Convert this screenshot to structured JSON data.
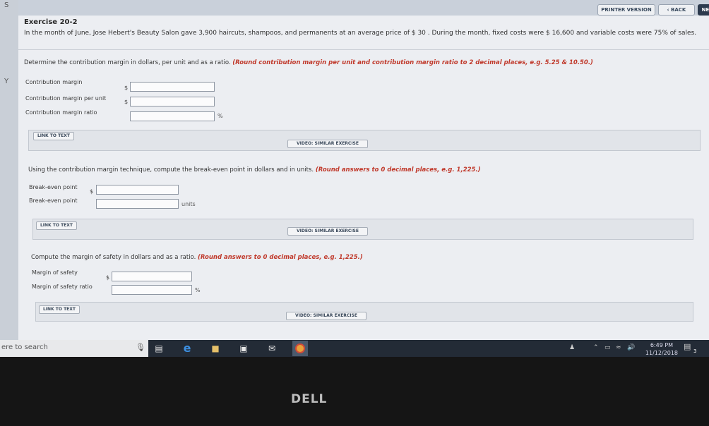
{
  "left_strip": {
    "top_char": "S",
    "mid_char": "Y"
  },
  "header": {
    "printer_version": "PRINTER VERSION",
    "back": "‹ BACK",
    "next": "NE"
  },
  "exercise": {
    "title": "Exercise 20-2",
    "problem": "In the month of June, Jose Hebert's Beauty Salon gave 3,900 haircuts, shampoos, and permanents at an average price of $ 30 . During the month, fixed costs were $ 16,600 and variable costs were 75% of sales."
  },
  "part1": {
    "question": "Determine the contribution margin in dollars, per unit and as a ratio.",
    "instruction": "(Round contribution margin per unit and contribution margin ratio to 2 decimal places, e.g. 5.25 & 10.50.)",
    "rows": [
      {
        "label": "Contribution margin",
        "prefix": "$",
        "value": "",
        "suffix": ""
      },
      {
        "label": "Contribution margin per unit",
        "prefix": "$",
        "value": "",
        "suffix": ""
      },
      {
        "label": "Contribution margin ratio",
        "prefix": "",
        "value": "",
        "suffix": "%"
      }
    ],
    "link_to_text": "LINK TO TEXT",
    "video": "VIDEO: SIMILAR EXERCISE"
  },
  "part2": {
    "question": "Using the contribution margin technique, compute the break-even point in dollars and in units.",
    "instruction": "(Round answers to 0 decimal places, e.g. 1,225.)",
    "rows": [
      {
        "label": "Break-even point",
        "prefix": "$",
        "value": "",
        "suffix": ""
      },
      {
        "label": "Break-even point",
        "prefix": "",
        "value": "",
        "suffix": "units"
      }
    ],
    "link_to_text": "LINK TO TEXT",
    "video": "VIDEO: SIMILAR EXERCISE"
  },
  "part3": {
    "question": "Compute the margin of safety in dollars and as a ratio.",
    "instruction": "(Round answers to 0 decimal places, e.g. 1,225.)",
    "rows": [
      {
        "label": "Margin of safety",
        "prefix": "$",
        "value": "",
        "suffix": ""
      },
      {
        "label": "Margin of safety ratio",
        "prefix": "",
        "value": "",
        "suffix": "%"
      }
    ],
    "link_to_text": "LINK TO TEXT",
    "video": "VIDEO: SIMILAR EXERCISE"
  },
  "taskbar": {
    "search_text": "ere to search",
    "time": "6:49 PM",
    "date": "11/12/2018",
    "icons": [
      "microphone-icon",
      "task-view-icon",
      "edge-icon",
      "file-explorer-icon",
      "store-icon",
      "mail-icon",
      "chrome-icon"
    ],
    "notification_count": "3"
  },
  "brand": "DELL",
  "colors": {
    "instruction_red": "#c0392b",
    "taskbar": "#232b36",
    "edge_blue": "#3d8fe0",
    "chrome": "#e8a23a"
  }
}
